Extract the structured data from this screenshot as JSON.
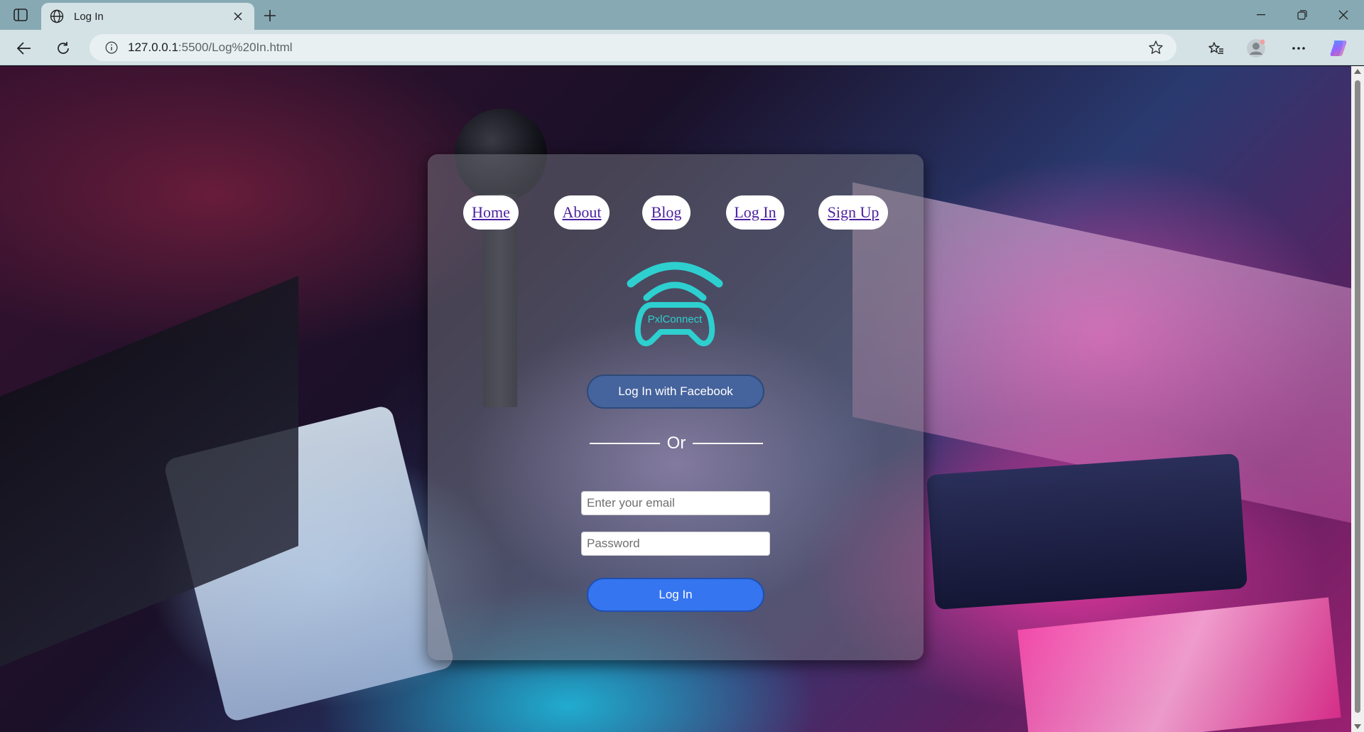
{
  "browser": {
    "tab_title": "Log In",
    "url_host": "127.0.0.1",
    "url_rest": ":5500/Log%20In.html"
  },
  "nav": {
    "links": [
      {
        "label": "Home"
      },
      {
        "label": "About"
      },
      {
        "label": "Blog"
      },
      {
        "label": "Log In"
      },
      {
        "label": "Sign Up"
      }
    ]
  },
  "logo": {
    "text": "PxlConnect",
    "color": "#2ecfcf"
  },
  "form": {
    "facebook_label": "Log In with Facebook",
    "divider_label": "Or",
    "email_placeholder": "Enter your email",
    "password_placeholder": "Password",
    "submit_label": "Log In"
  },
  "colors": {
    "facebook": "#45639c",
    "submit": "#3575f0",
    "link": "#4b1fa0"
  }
}
